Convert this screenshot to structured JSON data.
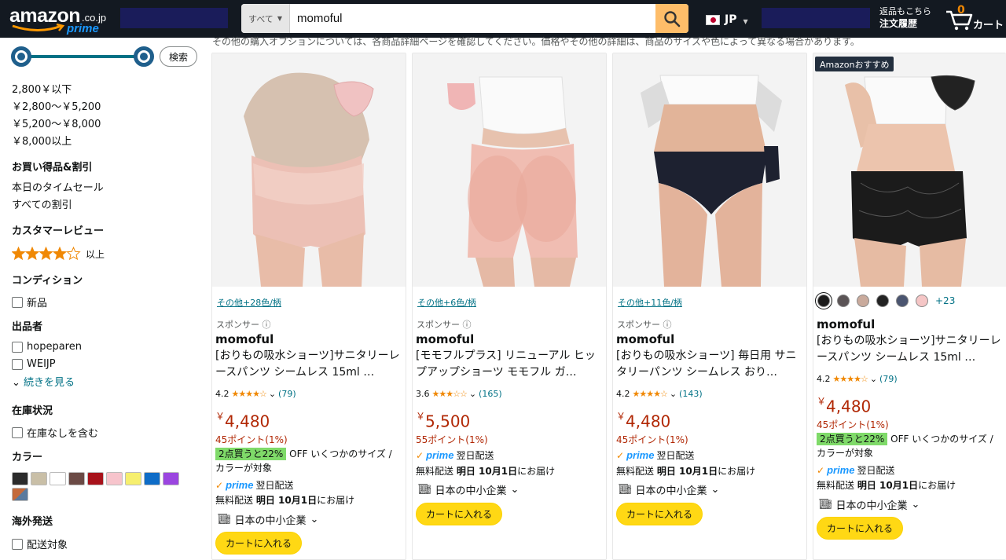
{
  "header": {
    "logo_text": "amazon",
    "logo_domain": ".co.jp",
    "logo_prime": "prime",
    "search_category": "すべて",
    "search_value": "momoful",
    "language": "JP",
    "orders_line1": "返品もこちら",
    "orders_line2": "注文履歴",
    "cart_count": "0",
    "cart_label": "カート"
  },
  "sidebar": {
    "go_button": "検索",
    "price_ranges": [
      "2,800￥以下",
      "￥2,800～￥5,200",
      "￥5,200～￥8,000",
      "￥8,000以上"
    ],
    "deals_heading": "お買い得品&割引",
    "deals": [
      "本日のタイムセール",
      "すべての割引"
    ],
    "review_heading": "カスタマーレビュー",
    "review_suffix": "以上",
    "review_stars": 4,
    "condition_heading": "コンディション",
    "condition_new": "新品",
    "seller_heading": "出品者",
    "sellers": [
      "hopeparen",
      "WEIJP"
    ],
    "see_more": "続きを見る",
    "stock_heading": "在庫状況",
    "stock_option": "在庫なしを含む",
    "color_heading": "カラー",
    "colors": [
      "#2b2b2b",
      "#c9bfa7",
      "#ffffff",
      "#6b4a45",
      "#a8121b",
      "#f7c4cc",
      "#f6ef6e",
      "#0e6cc7",
      "#9b45e0",
      "multi"
    ],
    "intl_heading": "海外発送",
    "intl_option": "配送対象"
  },
  "main": {
    "top_note": "その他の購入オプションについては、各商品詳細ページを確認してください。価格やその他の詳細は、商品のサイズや色によって異なる場合があります。",
    "products": [
      {
        "variants": "その他+28色/柄",
        "sponsor": "スポンサー",
        "brand": "momoful",
        "title": "[おりもの吸水ショーツ]サニタリーレースパンツ シームレス 15ml …",
        "rating": "4.2",
        "rating_stars": 4.2,
        "reviews": "(79)",
        "price_symbol": "￥",
        "price": "4,480",
        "points": "45ポイント(1%)",
        "deal_tag": "2点買うと22%",
        "deal_text": "OFF いくつかのサイズ / カラーが対象",
        "prime": "prime",
        "prime_delivery": "翌日配送",
        "ship_prefix": "無料配送",
        "ship_date": "明日 10月1日",
        "ship_suffix": "にお届け",
        "smb": "日本の中小企業",
        "cart_button": "カートに入れる"
      },
      {
        "variants": "その他+6色/柄",
        "sponsor": "スポンサー",
        "brand": "momoful",
        "title": "[モモフルプラス] リニューアル ヒップアップショーツ モモフル ガ…",
        "rating": "3.6",
        "rating_stars": 3.6,
        "reviews": "(165)",
        "price_symbol": "￥",
        "price": "5,500",
        "points": "55ポイント(1%)",
        "prime": "prime",
        "prime_delivery": "翌日配送",
        "ship_prefix": "無料配送",
        "ship_date": "明日 10月1日",
        "ship_suffix": "にお届け",
        "smb": "日本の中小企業",
        "cart_button": "カートに入れる"
      },
      {
        "variants": "その他+11色/柄",
        "sponsor": "スポンサー",
        "brand": "momoful",
        "title": "[おりもの吸水ショーツ] 毎日用 サニタリーパンツ シームレス おり…",
        "rating": "4.2",
        "rating_stars": 4.2,
        "reviews": "(143)",
        "price_symbol": "￥",
        "price": "4,480",
        "points": "45ポイント(1%)",
        "prime": "prime",
        "prime_delivery": "翌日配送",
        "ship_prefix": "無料配送",
        "ship_date": "明日 10月1日",
        "ship_suffix": "にお届け",
        "smb": "日本の中小企業",
        "cart_button": "カートに入れる"
      },
      {
        "badge": "Amazonおすすめ",
        "color_swatches": [
          "#1b1b1b",
          "#5b5456",
          "#c9aa9c",
          "#232323",
          "#4b5570",
          "#f5c6c6"
        ],
        "more_colors": "+23",
        "brand": "momoful",
        "title": "[おりもの吸水ショーツ]サニタリーレースパンツ シームレス 15ml …",
        "rating": "4.2",
        "rating_stars": 4.2,
        "reviews": "(79)",
        "price_symbol": "￥",
        "price": "4,480",
        "points": "45ポイント(1%)",
        "deal_tag": "2点買うと22%",
        "deal_text": "OFF いくつかのサイズ / カラーが対象",
        "prime": "prime",
        "prime_delivery": "翌日配送",
        "ship_prefix": "無料配送",
        "ship_date": "明日 10月1日",
        "ship_suffix": "にお届け",
        "smb": "日本の中小企業",
        "cart_button": "カートに入れる"
      }
    ]
  }
}
